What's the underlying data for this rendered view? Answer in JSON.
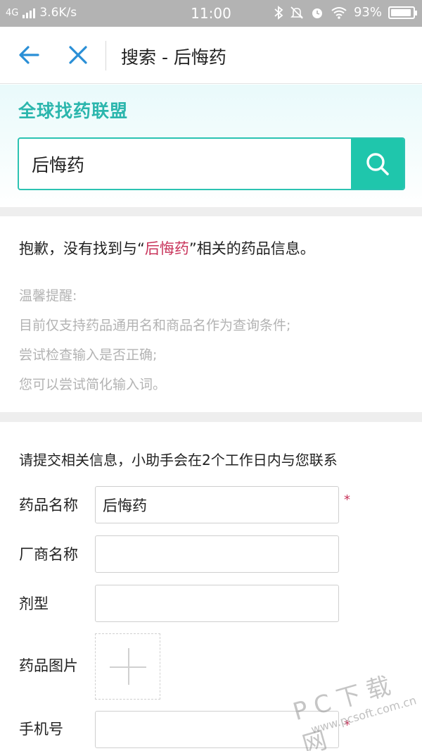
{
  "status_bar": {
    "network": "4G",
    "speed": "3.6K/s",
    "time": "11:00",
    "battery": "93%",
    "battery_level": 0.93,
    "icons": [
      "bluetooth-icon",
      "mute-icon",
      "alarm-icon",
      "wifi-icon"
    ]
  },
  "titlebar": {
    "title": "搜索 - 后悔药"
  },
  "hero": {
    "brand": "全球找药联盟",
    "search_value": "后悔药"
  },
  "result": {
    "msg_prefix": "抱歉，没有找到与“",
    "msg_keyword": "后悔药",
    "msg_suffix": "”相关的药品信息。",
    "tips": [
      "温馨提醒:",
      "目前仅支持药品通用名和商品名作为查询条件;",
      "尝试检查输入是否正确;",
      "您可以尝试简化输入词。"
    ]
  },
  "form": {
    "intro": "请提交相关信息，小助手会在2个工作日内与您联系",
    "drug_name_label": "药品名称",
    "drug_name_value": "后悔药",
    "maker_label": "厂商名称",
    "maker_value": "",
    "dosage_label": "剂型",
    "dosage_value": "",
    "image_label": "药品图片",
    "phone_label": "手机号",
    "phone_value": "",
    "required_mark": "*"
  },
  "watermark": {
    "big": "PC下载网",
    "small": "www.pcsoft.com.cn"
  },
  "colors": {
    "accent": "#1fc6ac",
    "brand": "#2bb6ad",
    "highlight": "#c8345b",
    "status_bar": "#b3b3b3"
  }
}
